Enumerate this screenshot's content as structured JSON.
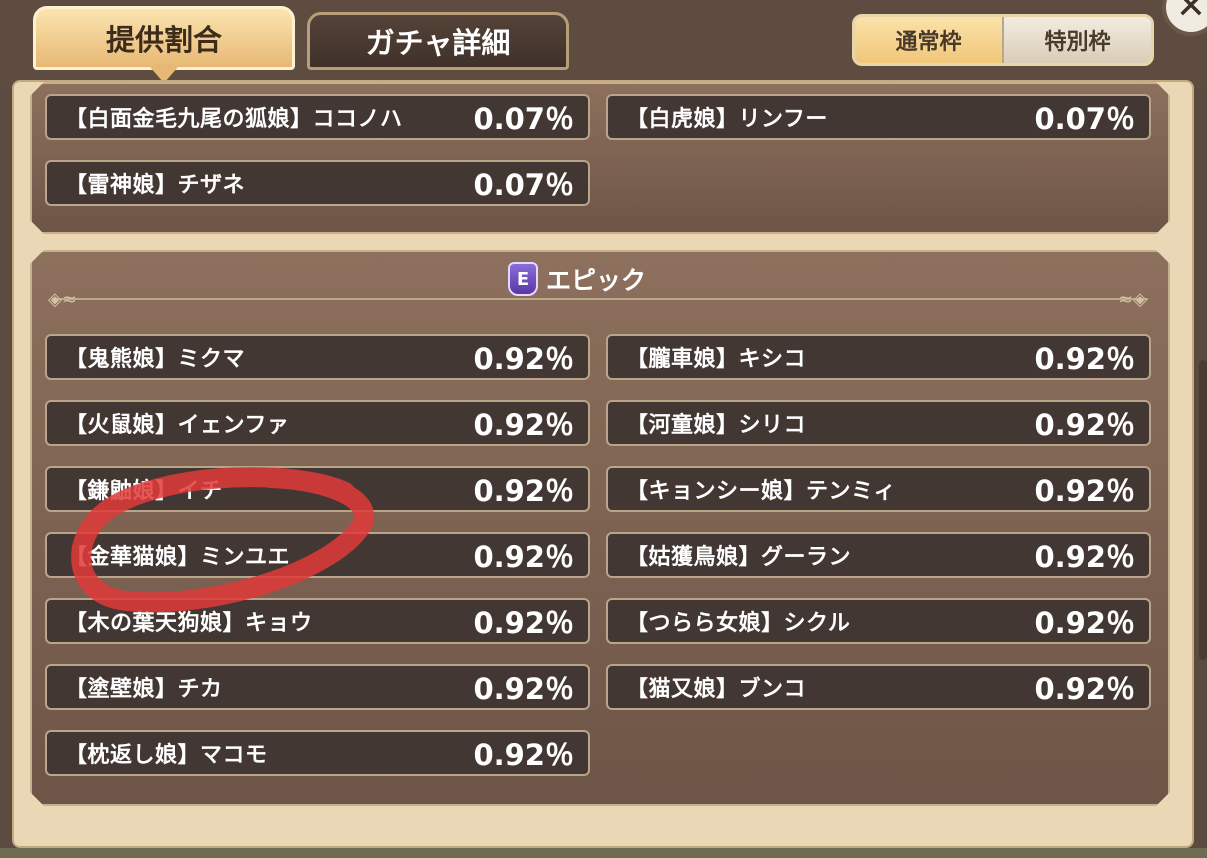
{
  "tabs": {
    "rates": "提供割合",
    "details": "ガチャ詳細"
  },
  "frame_toggle": {
    "normal": "通常枠",
    "special": "特別枠"
  },
  "close_glyph": "✕",
  "top_items": [
    {
      "name": "【白面金毛九尾の狐娘】ココノハ",
      "rate": "0.07％"
    },
    {
      "name": "【白虎娘】リンフー",
      "rate": "0.07％"
    },
    {
      "name": "【雷神娘】チザネ",
      "rate": "0.07％"
    }
  ],
  "epic": {
    "badge": "E",
    "title": "エピック",
    "items": [
      {
        "name": "【鬼熊娘】ミクマ",
        "rate": "0.92％"
      },
      {
        "name": "【朧車娘】キシコ",
        "rate": "0.92％"
      },
      {
        "name": "【火鼠娘】イェンファ",
        "rate": "0.92％"
      },
      {
        "name": "【河童娘】シリコ",
        "rate": "0.92％"
      },
      {
        "name": "【鎌鼬娘】イチ",
        "rate": "0.92％"
      },
      {
        "name": "【キョンシー娘】テンミィ",
        "rate": "0.92％"
      },
      {
        "name": "【金華猫娘】ミンユエ",
        "rate": "0.92％"
      },
      {
        "name": "【姑獲鳥娘】グーラン",
        "rate": "0.92％"
      },
      {
        "name": "【木の葉天狗娘】キョウ",
        "rate": "0.92％"
      },
      {
        "name": "【つらら女娘】シクル",
        "rate": "0.92％"
      },
      {
        "name": "【塗壁娘】チカ",
        "rate": "0.92％"
      },
      {
        "name": "【猫又娘】ブンコ",
        "rate": "0.92％"
      },
      {
        "name": "【枕返し娘】マコモ",
        "rate": "0.92％"
      }
    ]
  },
  "colors": {
    "accent": "#e7b873",
    "card_bg": "#433733",
    "annotation": "#e03a3a"
  }
}
